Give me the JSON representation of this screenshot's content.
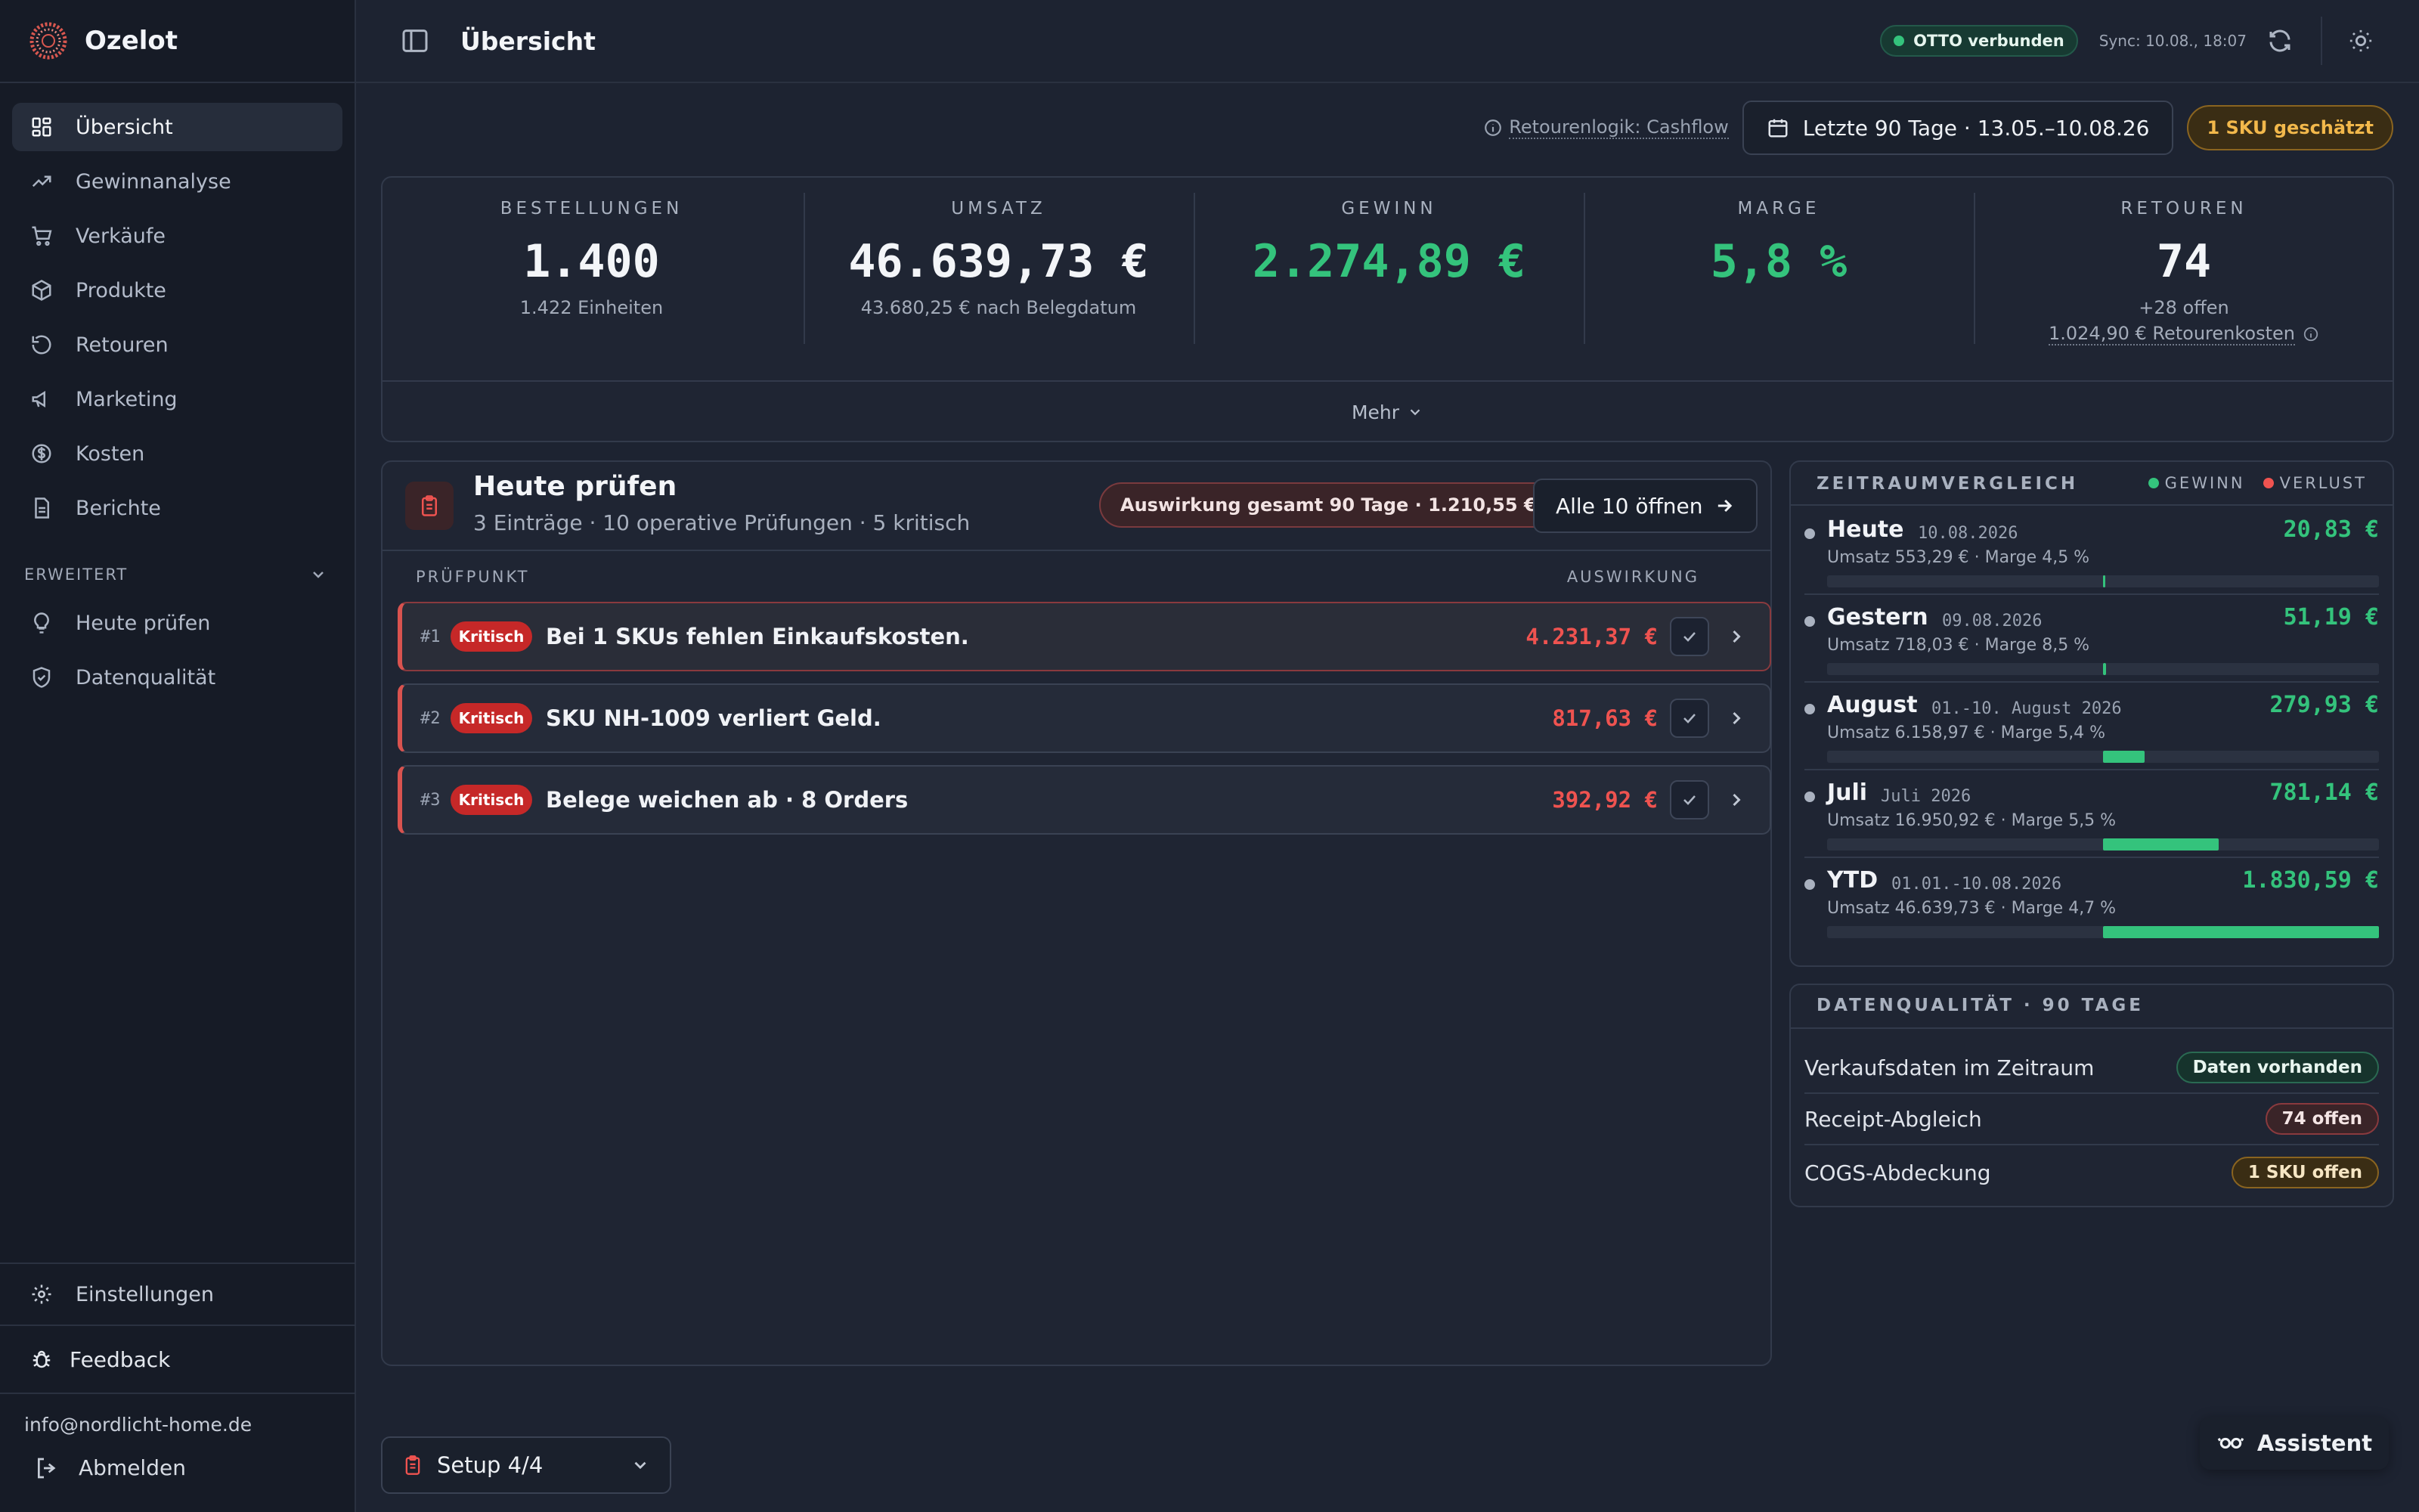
{
  "brand": {
    "name": "Ozelot"
  },
  "nav": {
    "items": [
      {
        "label": "Übersicht",
        "icon": "dashboard-icon"
      },
      {
        "label": "Gewinnanalyse",
        "icon": "trend-up-icon"
      },
      {
        "label": "Verkäufe",
        "icon": "cart-icon"
      },
      {
        "label": "Produkte",
        "icon": "package-icon"
      },
      {
        "label": "Retouren",
        "icon": "undo-icon"
      },
      {
        "label": "Marketing",
        "icon": "megaphone-icon"
      },
      {
        "label": "Kosten",
        "icon": "dollar-circle-icon"
      },
      {
        "label": "Berichte",
        "icon": "document-icon"
      }
    ],
    "section_label": "ERWEITERT",
    "advanced": [
      {
        "label": "Heute prüfen",
        "icon": "lightbulb-icon"
      },
      {
        "label": "Datenqualität",
        "icon": "shield-check-icon"
      }
    ],
    "settings_label": "Einstellungen",
    "feedback_label": "Feedback",
    "user_email": "info@nordlicht-home.de",
    "logout_label": "Abmelden"
  },
  "topbar": {
    "title": "Übersicht",
    "connection": "OTTO verbunden",
    "sync": "Sync: 10.08., 18:07"
  },
  "filters": {
    "return_logic": "Retourenlogik: Cashflow",
    "date_range": "Letzte 90 Tage · 13.05.–10.08.26",
    "estimate_badge": "1 SKU geschätzt"
  },
  "kpis": [
    {
      "label": "BESTELLUNGEN",
      "value": "1.400",
      "sub": "1.422 Einheiten"
    },
    {
      "label": "UMSATZ",
      "value": "46.639,73 €",
      "sub": "43.680,25 € nach Belegdatum"
    },
    {
      "label": "GEWINN",
      "value": "2.274,89 €",
      "sub": ""
    },
    {
      "label": "MARGE",
      "value": "5,8 %",
      "sub": ""
    },
    {
      "label": "RETOUREN",
      "value": "74",
      "sub": "+28 offen",
      "sub2": "1.024,90 € Retourenkosten"
    }
  ],
  "more_label": "Mehr",
  "today": {
    "title": "Heute prüfen",
    "subtitle": "3 Einträge · 10 operative Prüfungen · 5 kritisch",
    "impact_badge": "Auswirkung gesamt 90 Tage · 1.210,55 €",
    "open_all": "Alle 10 öffnen",
    "col_check": "PRÜFPUNKT",
    "col_impact": "AUSWIRKUNG",
    "issues": [
      {
        "num": "#1",
        "tag": "Kritisch",
        "text": "Bei 1 SKUs fehlen Einkaufskosten.",
        "impact": "4.231,37 €"
      },
      {
        "num": "#2",
        "tag": "Kritisch",
        "text": "SKU NH-1009 verliert Geld.",
        "impact": "817,63 €"
      },
      {
        "num": "#3",
        "tag": "Kritisch",
        "text": "Belege weichen ab · 8 Orders",
        "impact": "392,92 €"
      }
    ]
  },
  "compare": {
    "title": "ZEITRAUMVERGLEICH",
    "legend_gain": "GEWINN",
    "legend_loss": "VERLUST",
    "colors": {
      "gain": "#34c37c",
      "loss": "#ef5350"
    },
    "rows": [
      {
        "label": "Heute",
        "date": "10.08.2026",
        "value": "20,83 €",
        "meta": "Umsatz 553,29 € · Marge 4,5 %",
        "fraction": 0.005
      },
      {
        "label": "Gestern",
        "date": "09.08.2026",
        "value": "51,19 €",
        "meta": "Umsatz 718,03 € · Marge 8,5 %",
        "fraction": 0.012
      },
      {
        "label": "August",
        "date": "01.-10. August 2026",
        "value": "279,93 €",
        "meta": "Umsatz 6.158,97 € · Marge 5,4 %",
        "fraction": 0.15
      },
      {
        "label": "Juli",
        "date": "Juli 2026",
        "value": "781,14 €",
        "meta": "Umsatz 16.950,92 € · Marge 5,5 %",
        "fraction": 0.42
      },
      {
        "label": "YTD",
        "date": "01.01.-10.08.2026",
        "value": "1.830,59 €",
        "meta": "Umsatz 46.639,73 € · Marge 4,7 %",
        "fraction": 1.0
      }
    ]
  },
  "quality": {
    "title": "DATENQUALITÄT · 90 TAGE",
    "rows": [
      {
        "label": "Verkaufsdaten im Zeitraum",
        "badge": "Daten vorhanden"
      },
      {
        "label": "Receipt-Abgleich",
        "badge": "74 offen"
      },
      {
        "label": "COGS-Abdeckung",
        "badge": "1 SKU offen"
      }
    ]
  },
  "setup": {
    "label": "Setup 4/4"
  },
  "assistant": {
    "label": "Assistent"
  }
}
